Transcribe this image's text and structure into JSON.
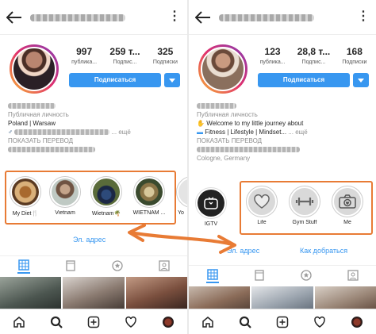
{
  "profiles": [
    {
      "stats": [
        {
          "value": "997",
          "label": "публика..."
        },
        {
          "value": "259 т...",
          "label": "Подпис..."
        },
        {
          "value": "325",
          "label": "Подписки"
        }
      ],
      "follow_label": "Подписаться",
      "bio": {
        "category": "Публичная личность",
        "lines": [
          "Poland | Warsaw"
        ],
        "more": "... ещё",
        "translate": "ПОКАЗАТЬ ПЕРЕВОД"
      },
      "highlights": [
        {
          "label": "My Diet🍴"
        },
        {
          "label": "Vietnam"
        },
        {
          "label": "Wietnam🌴"
        },
        {
          "label": "WIETNAM ..."
        },
        {
          "label": "Yo"
        }
      ],
      "address_label": "Эл. адрес"
    },
    {
      "stats": [
        {
          "value": "123",
          "label": "публика..."
        },
        {
          "value": "28,8 т...",
          "label": "Подпис..."
        },
        {
          "value": "168",
          "label": "Подписки"
        }
      ],
      "follow_label": "Подписаться",
      "bio": {
        "category": "Публичная личность",
        "lines": [
          "Welcome to my little journey about",
          "Fitness | Lifestyle | Mindset..."
        ],
        "more": "... ещё",
        "translate": "ПОКАЗАТЬ ПЕРЕВОД",
        "location": "Cologne, Germany"
      },
      "highlights": [
        {
          "label": "IGTV"
        },
        {
          "label": "Life"
        },
        {
          "label": "Gym Stuff"
        },
        {
          "label": "Me"
        }
      ],
      "address_label": "Эл. адрес",
      "directions_label": "Как добраться"
    }
  ],
  "accent_color": "#3897f0",
  "annotation_color": "#e87b35"
}
